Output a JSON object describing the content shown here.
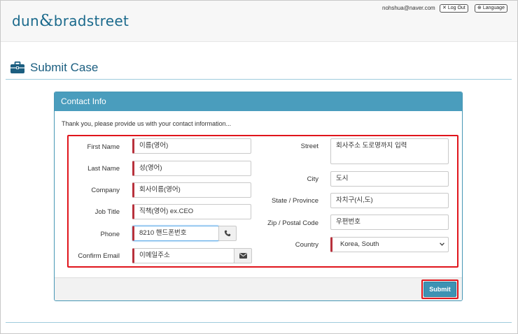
{
  "header": {
    "logo_left": "dun",
    "logo_amp": "&",
    "logo_right": "bradstreet",
    "user_email": "nohshua@naver.com",
    "logout_label": "Log Out",
    "language_label": "Language"
  },
  "page": {
    "title": "Submit Case"
  },
  "panel": {
    "header": "Contact Info",
    "intro": "Thank you, please provide us with your contact information..."
  },
  "form": {
    "first_name": {
      "label": "First Name",
      "value": "이름(영어)"
    },
    "last_name": {
      "label": "Last Name",
      "value": "성(영어)"
    },
    "company": {
      "label": "Company",
      "value": "회사이름(영어)"
    },
    "job_title": {
      "label": "Job Title",
      "value": "직책(영어) ex.CEO"
    },
    "phone": {
      "label": "Phone",
      "value": "8210 핸드폰번호"
    },
    "confirm_email": {
      "label": "Confirm Email",
      "value": "이메일주소"
    },
    "street": {
      "label": "Street",
      "value": "회사주소 도로명까지 입력"
    },
    "city": {
      "label": "City",
      "value": "도시"
    },
    "state": {
      "label": "State / Province",
      "value": "자치구(시,도)"
    },
    "zip": {
      "label": "Zip / Postal Code",
      "value": "우편번호"
    },
    "country": {
      "label": "Country",
      "value": "Korea, South"
    }
  },
  "actions": {
    "submit_label": "Submit"
  },
  "colors": {
    "brand": "#1b6a8c",
    "panel_header": "#4a9dbd",
    "required_marker": "#b8313c",
    "highlight": "#e0151c",
    "submit": "#3d92b3"
  }
}
